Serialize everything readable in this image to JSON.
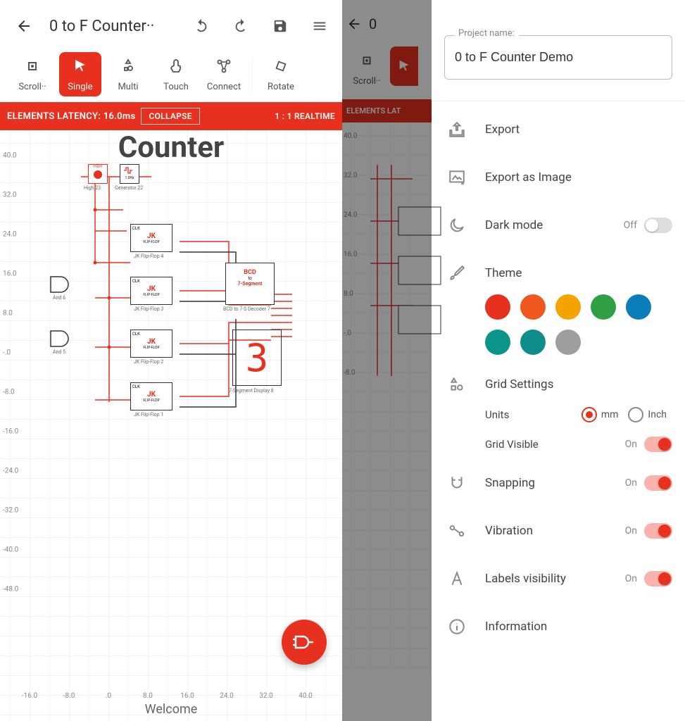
{
  "header": {
    "title": "0 to F Counter··"
  },
  "toolbar": {
    "scroll": "Scroll··",
    "single": "Single",
    "multi": "Multi",
    "touch": "Touch",
    "connect": "Connect",
    "rotate": "Rotate"
  },
  "banner": {
    "latency_label": "ELEMENTS LATENCY:",
    "latency_value": "16.0ms",
    "collapse": "COLLAPSE",
    "realtime": "1 : 1 REALTIME"
  },
  "canvas": {
    "title": "Counter",
    "welcome": "Welcome",
    "y_ticks": [
      "40.0",
      "32.0",
      "24.0",
      "16.0",
      "8.0",
      "-.0",
      "-8.0",
      "-16.0",
      "-24.0",
      "-32.0",
      "-40.0",
      "-48.0"
    ],
    "x_ticks": [
      "-16.0",
      "-8.0",
      ".0",
      "8.0",
      "16.0",
      "24.0",
      "32.0",
      "40.0"
    ],
    "components": {
      "high": "High 23",
      "generator": "Generator 22",
      "gen_freq": "1.0Hz",
      "jk4": "JK Flip-Flop 4",
      "jk3": "JK Flip-Flop 3",
      "jk2": "JK Flip-Flop 2",
      "jk1": "JK Flip-Flop 1",
      "and6": "And 6",
      "and5": "And 5",
      "bcd": "BCD to 7-S Decoder 7",
      "bcd_hdr1": "BCD",
      "bcd_hdr2": "to",
      "bcd_hdr3": "7-Segment",
      "seg7_label": "7-Segment Display 8",
      "seg7_digit": "3",
      "jk_hdr": "JK",
      "jk_sub": "FLIP-FLOP",
      "clk": "CLK"
    }
  },
  "middle": {
    "title": "0",
    "scroll": "Scroll··",
    "banner": "ELEMENTS LAT",
    "y_ticks": [
      "40.0",
      "32.0",
      "24.0",
      "16.0",
      "8.0",
      "-.0",
      "-8.0"
    ]
  },
  "drawer": {
    "project_name_label": "Project name:",
    "project_name_value": "0 to F Counter Demo",
    "export": "Export",
    "export_image": "Export as Image",
    "dark_mode": "Dark mode",
    "dark_mode_state": "Off",
    "theme": "Theme",
    "theme_colors": [
      "#e8301f",
      "#f0571e",
      "#f4a300",
      "#2f9e44",
      "#0b7db8",
      "#0b9488",
      "#0f8d8d",
      "#9e9e9e"
    ],
    "grid_settings": "Grid Settings",
    "units": "Units",
    "unit_mm": "mm",
    "unit_inch": "Inch",
    "grid_visible": "Grid Visible",
    "grid_visible_state": "On",
    "snapping": "Snapping",
    "snapping_state": "On",
    "vibration": "Vibration",
    "vibration_state": "On",
    "labels_visibility": "Labels visibility",
    "labels_state": "On",
    "information": "Information"
  }
}
